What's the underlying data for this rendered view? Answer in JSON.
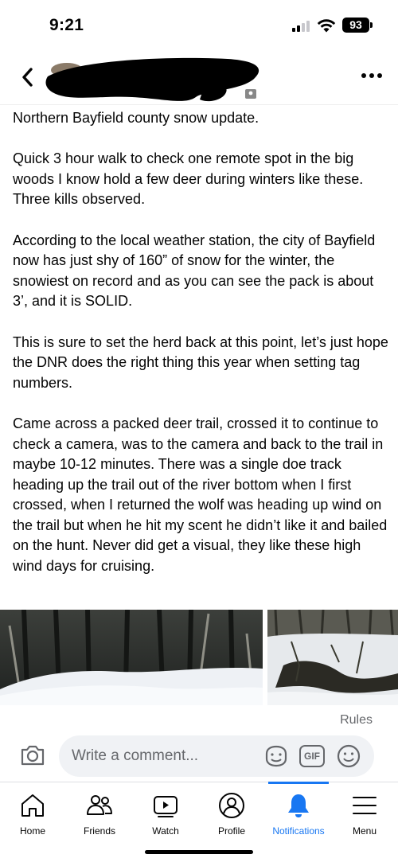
{
  "status_bar": {
    "time": "9:21",
    "battery": "93",
    "signal_bars": 2,
    "signal_bars_total": 4
  },
  "header": {
    "back_icon": "chevron-left-icon",
    "more_icon": "more-horizontal-icon"
  },
  "post": {
    "paragraphs": [
      "Northern Bayfield county snow update.",
      "Quick 3 hour walk to check one remote spot in the big woods I know hold a few deer during winters like these. Three kills observed.",
      "According to the local weather station, the city of Bayfield now has just shy of 160” of snow for the winter, the snowiest on record and as you can see the pack is about 3’, and it is SOLID.",
      "This is sure to set the herd back at this point, let’s just hope the DNR does the right thing this year when setting tag numbers.",
      "Came across a packed deer trail, crossed it to continue to check a camera, was to the camera and back to the trail in maybe 10-12 minutes. There was a single doe track heading up the trail out of the river bottom when I first crossed, when I returned the wolf was heading up wind on the trail but when he hit my scent he didn’t like it and bailed on the hunt. Never did get a visual, they like these high wind days for cruising."
    ]
  },
  "photos": [
    "snowy-woods-photo",
    "snow-pack-photo"
  ],
  "rules_label": "Rules",
  "comment": {
    "placeholder": "Write a comment...",
    "gif_label": "GIF"
  },
  "tabs": [
    {
      "label": "Home",
      "icon": "home-icon",
      "active": false
    },
    {
      "label": "Friends",
      "icon": "friends-icon",
      "active": false
    },
    {
      "label": "Watch",
      "icon": "watch-icon",
      "active": false
    },
    {
      "label": "Profile",
      "icon": "profile-icon",
      "active": false
    },
    {
      "label": "Notifications",
      "icon": "bell-icon",
      "active": true
    },
    {
      "label": "Menu",
      "icon": "menu-icon",
      "active": false
    }
  ],
  "colors": {
    "accent": "#1877f2",
    "text": "#050505",
    "secondary_text": "#65676b",
    "input_bg": "#f0f2f5"
  }
}
